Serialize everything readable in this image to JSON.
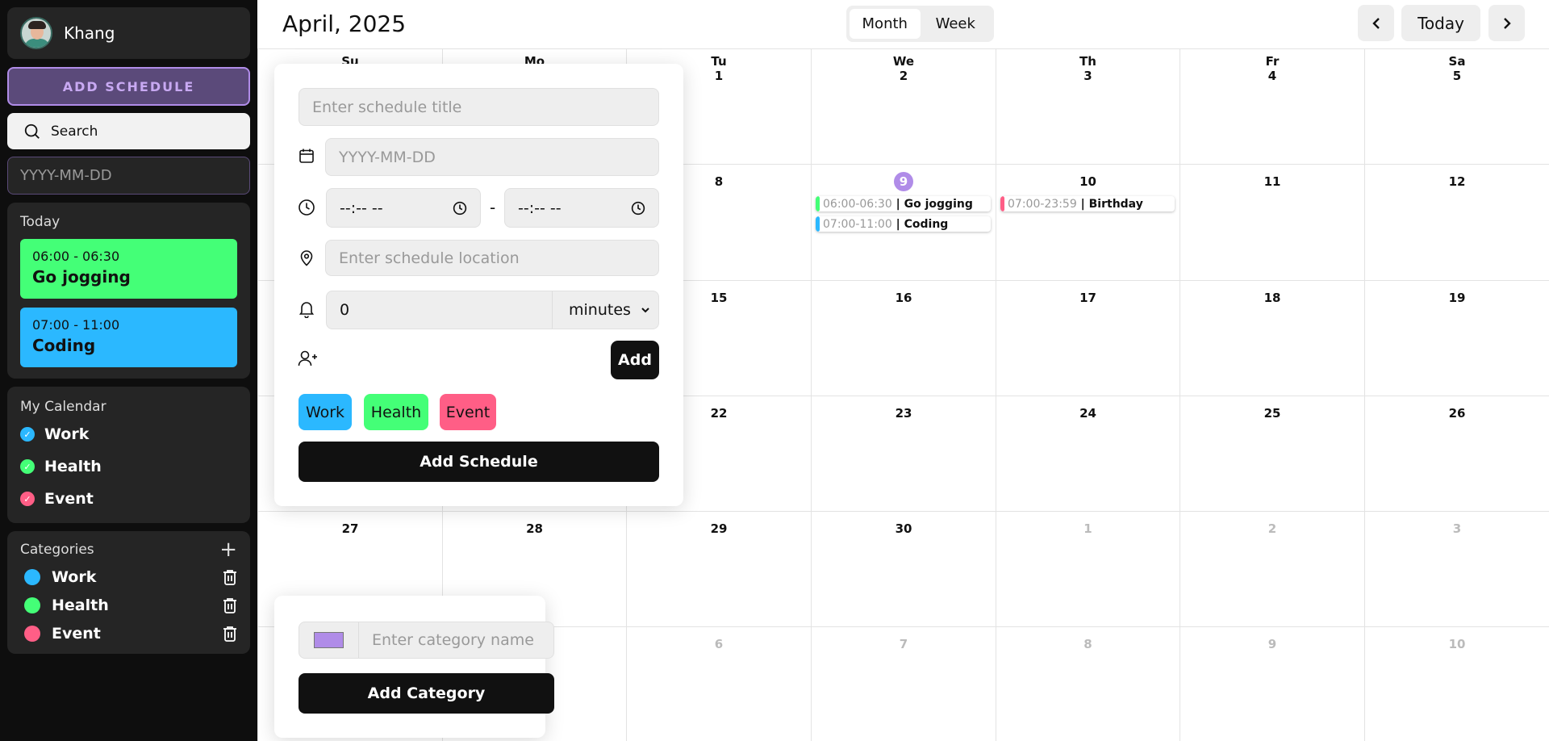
{
  "user": {
    "name": "Khang"
  },
  "sidebar": {
    "add_schedule_label": "ADD SCHEDULE",
    "search_label": "Search",
    "date_placeholder": "YYYY-MM-DD",
    "today_label": "Today",
    "today_events": [
      {
        "time": "06:00 - 06:30",
        "title": "Go jogging",
        "color": "#44ff77"
      },
      {
        "time": "07:00 - 11:00",
        "title": "Coding",
        "color": "#2bb8ff"
      }
    ],
    "my_calendar_label": "My Calendar",
    "calendars": [
      {
        "label": "Work",
        "color": "#2bb8ff"
      },
      {
        "label": "Health",
        "color": "#44ff77"
      },
      {
        "label": "Event",
        "color": "#ff5e86"
      }
    ],
    "categories_label": "Categories",
    "categories": [
      {
        "label": "Work",
        "color": "#2bb8ff"
      },
      {
        "label": "Health",
        "color": "#44ff77"
      },
      {
        "label": "Event",
        "color": "#ff5e86"
      }
    ]
  },
  "header": {
    "title": "April, 2025",
    "view_month": "Month",
    "view_week": "Week",
    "today_button": "Today"
  },
  "calendar": {
    "weekdays": [
      "Su",
      "Mo",
      "Tu",
      "We",
      "Th",
      "Fr",
      "Sa"
    ],
    "weeks": [
      [
        "",
        "",
        "1",
        "2",
        "3",
        "4",
        "5"
      ],
      [
        "",
        "",
        "8",
        "9",
        "10",
        "11",
        "12"
      ],
      [
        "",
        "",
        "15",
        "16",
        "17",
        "18",
        "19"
      ],
      [
        "",
        "",
        "22",
        "23",
        "24",
        "25",
        "26"
      ],
      [
        "27",
        "28",
        "29",
        "30",
        "1",
        "2",
        "3"
      ],
      [
        "",
        "",
        "6",
        "7",
        "8",
        "9",
        "10"
      ]
    ],
    "events": [
      {
        "time": "06:00-06:30",
        "name": "Go jogging",
        "color": "#44ff77"
      },
      {
        "time": "07:00-11:00",
        "name": "Coding",
        "color": "#2bb8ff"
      },
      {
        "time": "07:00-23:59",
        "name": "Birthday",
        "color": "#ff5e86"
      }
    ],
    "today_date": "9"
  },
  "schedule_form": {
    "title_placeholder": "Enter schedule title",
    "date_placeholder": "YYYY-MM-DD",
    "time_start": "--:-- --",
    "time_end": "--:-- --",
    "time_separator": "-",
    "location_placeholder": "Enter schedule location",
    "reminder_value": "0",
    "reminder_unit": "minutes",
    "add_guest_label": "Add",
    "categories": [
      {
        "label": "Work",
        "color": "#2bb8ff"
      },
      {
        "label": "Health",
        "color": "#44ff77"
      },
      {
        "label": "Event",
        "color": "#ff5e86"
      }
    ],
    "submit_label": "Add Schedule"
  },
  "category_form": {
    "name_placeholder": "Enter category name",
    "color_value": "#b08ce8",
    "submit_label": "Add Category"
  }
}
